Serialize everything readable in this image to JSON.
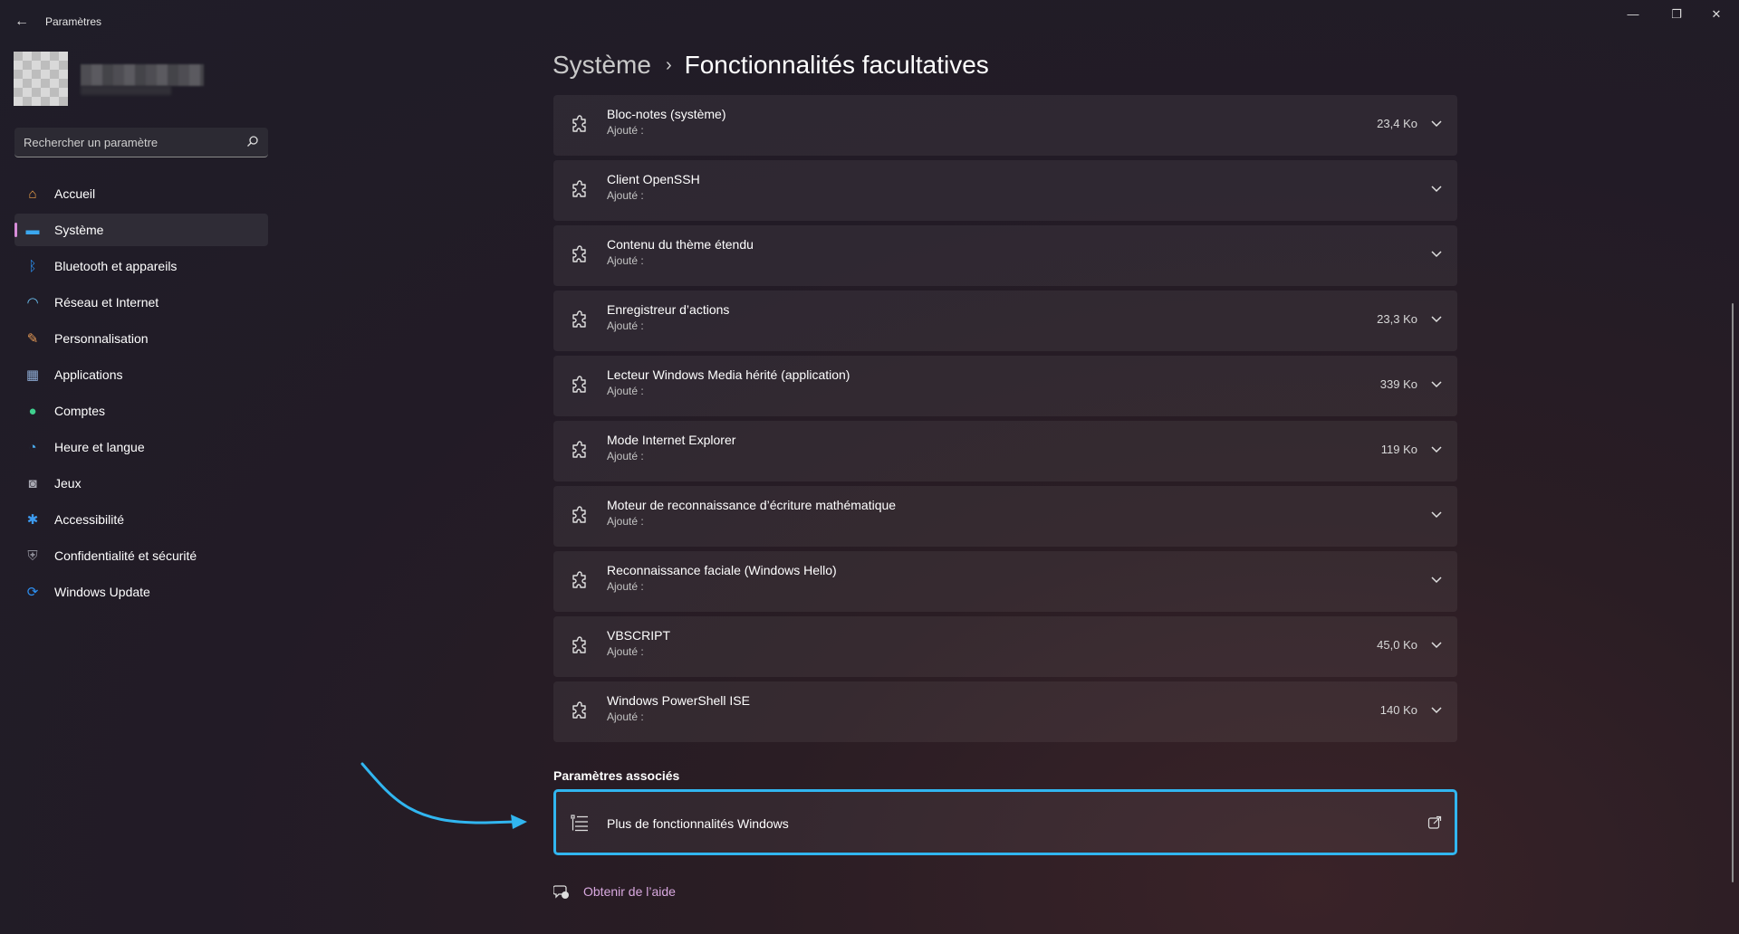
{
  "window": {
    "title": "Paramètres",
    "back_glyph": "←",
    "min_glyph": "—",
    "max_glyph": "❐",
    "close_glyph": "✕"
  },
  "search": {
    "placeholder": "Rechercher un paramètre"
  },
  "nav": [
    {
      "label": "Accueil",
      "icon": "home-icon",
      "glyph": "⌂",
      "color": "#f0a34a"
    },
    {
      "label": "Système",
      "icon": "monitor-icon",
      "glyph": "▬",
      "color": "#3ba7ef",
      "active": true
    },
    {
      "label": "Bluetooth et appareils",
      "icon": "bluetooth-icon",
      "glyph": "ᛒ",
      "color": "#2b8ff0"
    },
    {
      "label": "Réseau et Internet",
      "icon": "wifi-icon",
      "glyph": "◠",
      "color": "#6cc3f5"
    },
    {
      "label": "Personnalisation",
      "icon": "brush-icon",
      "glyph": "✎",
      "color": "#e59a55"
    },
    {
      "label": "Applications",
      "icon": "apps-icon",
      "glyph": "▦",
      "color": "#8aa7cf"
    },
    {
      "label": "Comptes",
      "icon": "account-icon",
      "glyph": "●",
      "color": "#3fcf8e"
    },
    {
      "label": "Heure et langue",
      "icon": "globe-clock-icon",
      "glyph": "◔",
      "color": "#4aa8e8"
    },
    {
      "label": "Jeux",
      "icon": "gamepad-icon",
      "glyph": "◙",
      "color": "#a9a9b3"
    },
    {
      "label": "Accessibilité",
      "icon": "accessibility-icon",
      "glyph": "✱",
      "color": "#3d9bf0"
    },
    {
      "label": "Confidentialité et sécurité",
      "icon": "shield-icon",
      "glyph": "⛨",
      "color": "#8e8e98"
    },
    {
      "label": "Windows Update",
      "icon": "update-icon",
      "glyph": "⟳",
      "color": "#2d8ff0"
    }
  ],
  "breadcrumb": {
    "parent": "Système",
    "separator": "›",
    "current": "Fonctionnalités facultatives"
  },
  "features": [
    {
      "name": "Bloc-notes (système)",
      "status": "Ajouté :",
      "size": "23,4 Ko"
    },
    {
      "name": "Client OpenSSH",
      "status": "Ajouté :",
      "size": ""
    },
    {
      "name": "Contenu du thème étendu",
      "status": "Ajouté :",
      "size": ""
    },
    {
      "name": "Enregistreur d’actions",
      "status": "Ajouté :",
      "size": "23,3 Ko"
    },
    {
      "name": "Lecteur Windows Media hérité (application)",
      "status": "Ajouté :",
      "size": "339 Ko"
    },
    {
      "name": "Mode Internet Explorer",
      "status": "Ajouté :",
      "size": "119 Ko"
    },
    {
      "name": "Moteur de reconnaissance d’écriture mathématique",
      "status": "Ajouté :",
      "size": ""
    },
    {
      "name": "Reconnaissance faciale (Windows Hello)",
      "status": "Ajouté :",
      "size": ""
    },
    {
      "name": "VBSCRIPT",
      "status": "Ajouté :",
      "size": "45,0 Ko"
    },
    {
      "name": "Windows PowerShell ISE",
      "status": "Ajouté :",
      "size": "140 Ko"
    }
  ],
  "related": {
    "title": "Paramètres associés",
    "item_label": "Plus de fonctionnalités Windows"
  },
  "help": {
    "label": "Obtenir de l’aide"
  },
  "colors": {
    "accent_highlight": "#31b6f0",
    "nav_active_indicator": "#d78cd9",
    "help_link": "#d9a9e0"
  }
}
